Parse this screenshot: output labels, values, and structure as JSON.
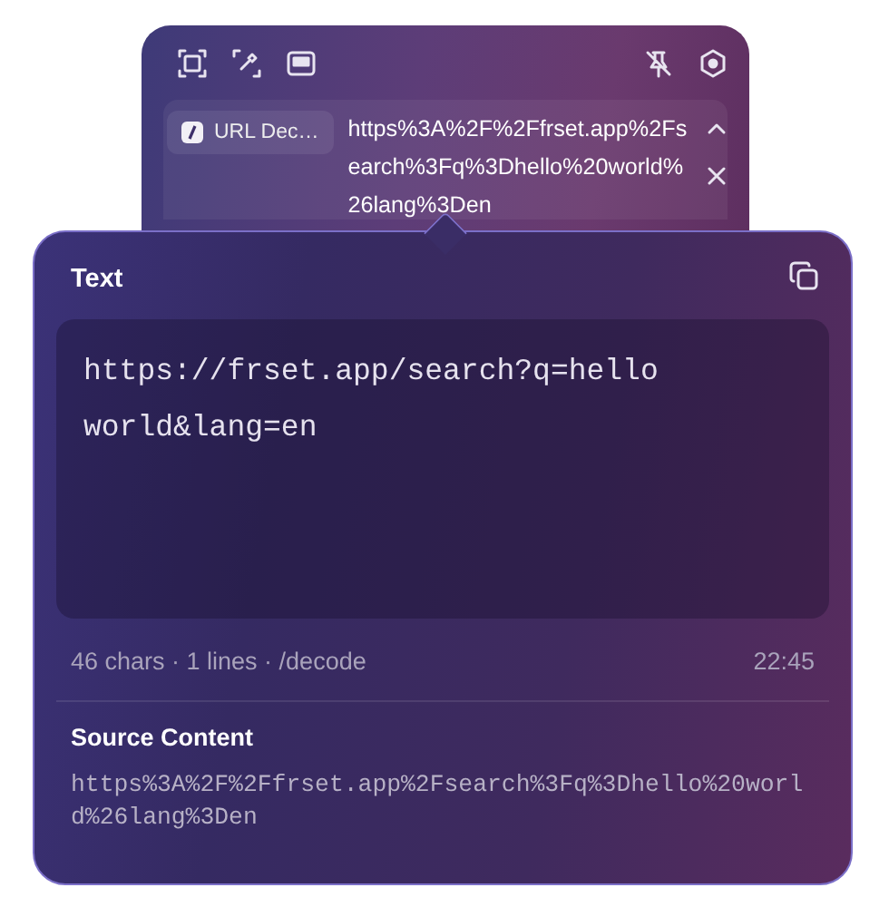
{
  "result_row": {
    "chip": "URL Dec…",
    "encoded": "https%3A%2F%2Ffrset.app%2Fsearch%3Fq%3Dhello%20world%26lang%3Den"
  },
  "panel": {
    "title": "Text",
    "output": "https://frset.app/search?q=hello world&lang=en",
    "stats": "46 chars · 1 lines · /decode",
    "time": "22:45",
    "source_title": "Source Content",
    "source": "https%3A%2F%2Ffrset.app%2Fsearch%3Fq%3Dhello%20world%26lang%3Den"
  }
}
